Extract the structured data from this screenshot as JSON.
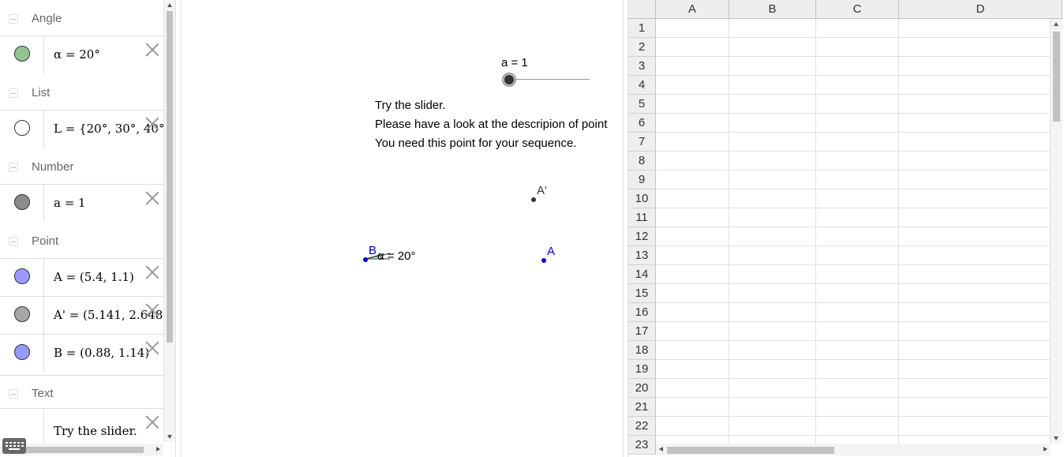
{
  "algebra": {
    "sections": [
      {
        "title": "Angle"
      },
      {
        "title": "List"
      },
      {
        "title": "Number"
      },
      {
        "title": "Point"
      },
      {
        "title": "Text"
      }
    ],
    "items": [
      {
        "expr": "α = 20°",
        "color": "#93c393"
      },
      {
        "expr": "L = {20°, 30°, 40°",
        "color": "#ffffff"
      },
      {
        "expr": "a = 1",
        "color": "#8c8c8c"
      },
      {
        "expr": "A = (5.4, 1.1)",
        "color": "#9999ff"
      },
      {
        "expr": "A' = (5.141, 2.648",
        "color": "#a6a6a6"
      },
      {
        "expr": "B = (0.88, 1.14)",
        "color": "#9999ff"
      },
      {
        "expr": "Try the slider.",
        "color": null
      }
    ]
  },
  "graphics": {
    "slider_label": "a = 1",
    "text_lines": [
      "Try the slider.",
      "Please have a look at the descripion of point",
      "You need this point for your sequence."
    ],
    "points": {
      "A_label": "A",
      "A_prime_label": "A'",
      "B_label": "B"
    },
    "angle_label": "α = 20°",
    "colors": {
      "blue_point": "#0000cc",
      "dark_point": "#333333"
    }
  },
  "spreadsheet": {
    "columns": [
      "A",
      "B",
      "C",
      "D"
    ],
    "rows": [
      "1",
      "2",
      "3",
      "4",
      "5",
      "6",
      "7",
      "8",
      "9",
      "10",
      "11",
      "12",
      "13",
      "14",
      "15",
      "16",
      "17",
      "18",
      "19",
      "20",
      "21",
      "22",
      "23"
    ]
  }
}
